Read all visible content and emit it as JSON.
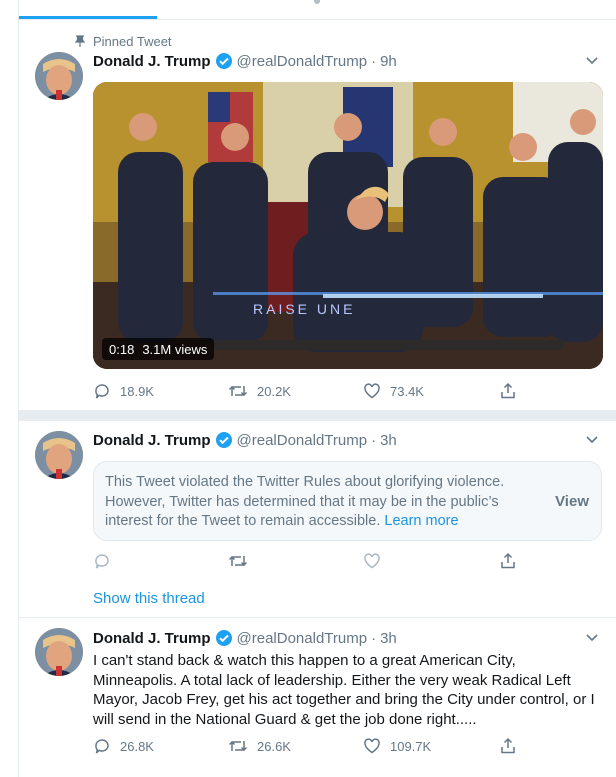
{
  "pinned_label": "Pinned Tweet",
  "tweets": [
    {
      "name": "Donald J. Trump",
      "handle": "@realDonaldTrump",
      "time": "9h",
      "media": {
        "duration": "0:18",
        "views": "3.1M views",
        "overlay_text": "RAISE UNE"
      },
      "replies": "18.9K",
      "retweets": "20.2K",
      "likes": "73.4K"
    },
    {
      "name": "Donald J. Trump",
      "handle": "@realDonaldTrump",
      "time": "3h",
      "notice_text": "This Tweet violated the Twitter Rules about glorifying violence. However, Twitter has determined that it may be in the public’s interest for the Tweet to remain accessible.",
      "notice_link": "Learn more",
      "notice_view": "View",
      "show_thread": "Show this thread"
    },
    {
      "name": "Donald J. Trump",
      "handle": "@realDonaldTrump",
      "time": "3h",
      "text": "I can't stand back & watch this happen to a great American City, Minneapolis. A total lack of leadership. Either the very weak Radical Left Mayor, Jacob Frey, get his act together and bring the City under control, or I will send in the National Guard & get the job done right.....",
      "replies": "26.8K",
      "retweets": "26.6K",
      "likes": "109.7K"
    }
  ],
  "colors": {
    "accent": "#1da1f2",
    "link": "#1b95e0",
    "muted": "#657786",
    "divider": "#e6ecf0"
  },
  "icons": [
    "pin-icon",
    "verified-badge-icon",
    "chevron-down-icon",
    "reply-icon",
    "retweet-icon",
    "like-icon",
    "share-icon"
  ]
}
